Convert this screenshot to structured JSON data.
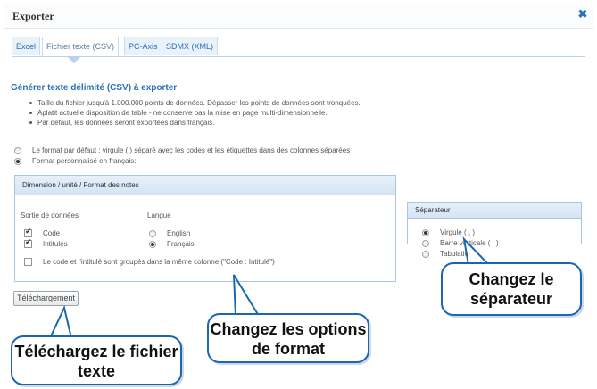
{
  "dialog": {
    "title": "Exporter",
    "close_icon": "close-icon",
    "tabs": [
      {
        "label": "Excel",
        "active": false
      },
      {
        "label": "Fichier texte (CSV)",
        "active": true
      },
      {
        "label": "PC-Axis",
        "active": false
      },
      {
        "label": "SDMX (XML)",
        "active": false
      }
    ]
  },
  "main": {
    "section_title": "Générer texte délimité (CSV) à exporter",
    "bullets": [
      "Taille du fichier jusqu'à 1.000.000 points de données. Dépasser les points de données sont tronquées.",
      "Aplatit actuelle disposition de table - ne conserve pas la mise en page multi-dimensionnelle.",
      "Par défaut, les données seront exportées dans français."
    ],
    "format_options": [
      {
        "label": "Le format par défaut : virgule (,) séparé avec les codes et les étiquettes dans des colonnes séparées",
        "selected": false
      },
      {
        "label": "Format personnalisé en français:",
        "selected": true
      }
    ]
  },
  "dimension_panel": {
    "header": "Dimension / unité / Format des notes",
    "output_label": "Sortie de données",
    "language_label": "Langue",
    "outputs": [
      {
        "label": "Code",
        "checked": true
      },
      {
        "label": "Intitulés",
        "checked": true
      }
    ],
    "languages": [
      {
        "label": "English",
        "selected": false
      },
      {
        "label": "Français",
        "selected": true
      }
    ],
    "grouped_label": "Le code et l'intitulé sont groupés dans la même colonne (\"Code : Intitulé\")",
    "grouped_checked": false
  },
  "separator_panel": {
    "header": "Séparateur",
    "options": [
      {
        "label": "Virgule ( , )",
        "selected": true
      },
      {
        "label": "Barre verticale ( | )",
        "selected": false
      },
      {
        "label": "Tabulation",
        "selected": false
      }
    ]
  },
  "download_button": "Téléchargement",
  "callouts": {
    "separator": "Changez le séparateur",
    "format": "Changez les options de format",
    "download": "Téléchargez le fichier texte"
  },
  "colors": {
    "accent": "#2b6fb6",
    "callout_border": "#1a66b0",
    "panel_header": "#d4e4f4"
  }
}
